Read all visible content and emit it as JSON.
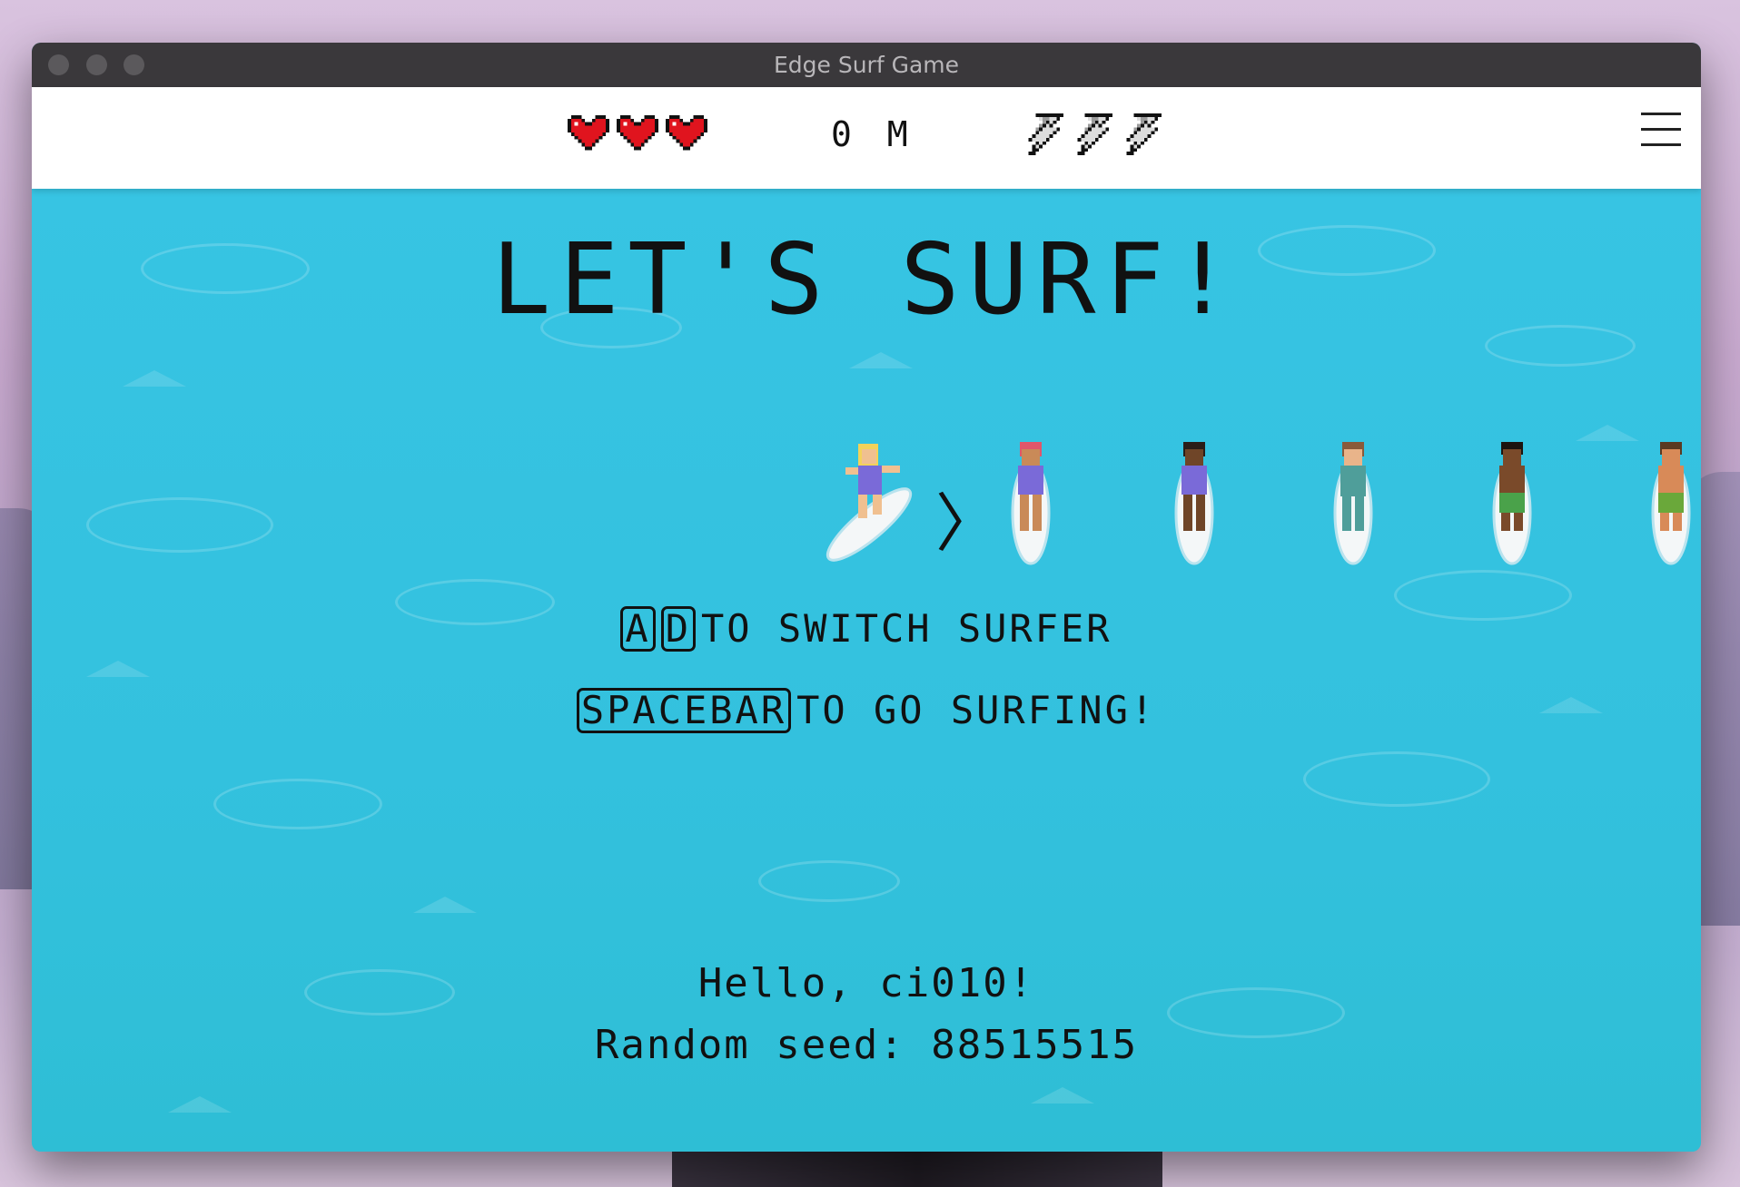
{
  "window": {
    "title": "Edge Surf Game"
  },
  "hud": {
    "lives": 3,
    "distance": "0 M",
    "boosts": 3
  },
  "main": {
    "headline": "LET'S SURF!",
    "switch_keys": [
      "A",
      "D"
    ],
    "switch_text": "TO SWITCH SURFER",
    "go_key": "SPACEBAR",
    "go_text": "TO GO SURFING!",
    "greeting": "Hello, ci010!",
    "seed_text": "Random seed: 88515515"
  },
  "colors": {
    "sea": "#34c0dd",
    "heart": "#e0141e",
    "hud_bg": "#ffffff"
  }
}
